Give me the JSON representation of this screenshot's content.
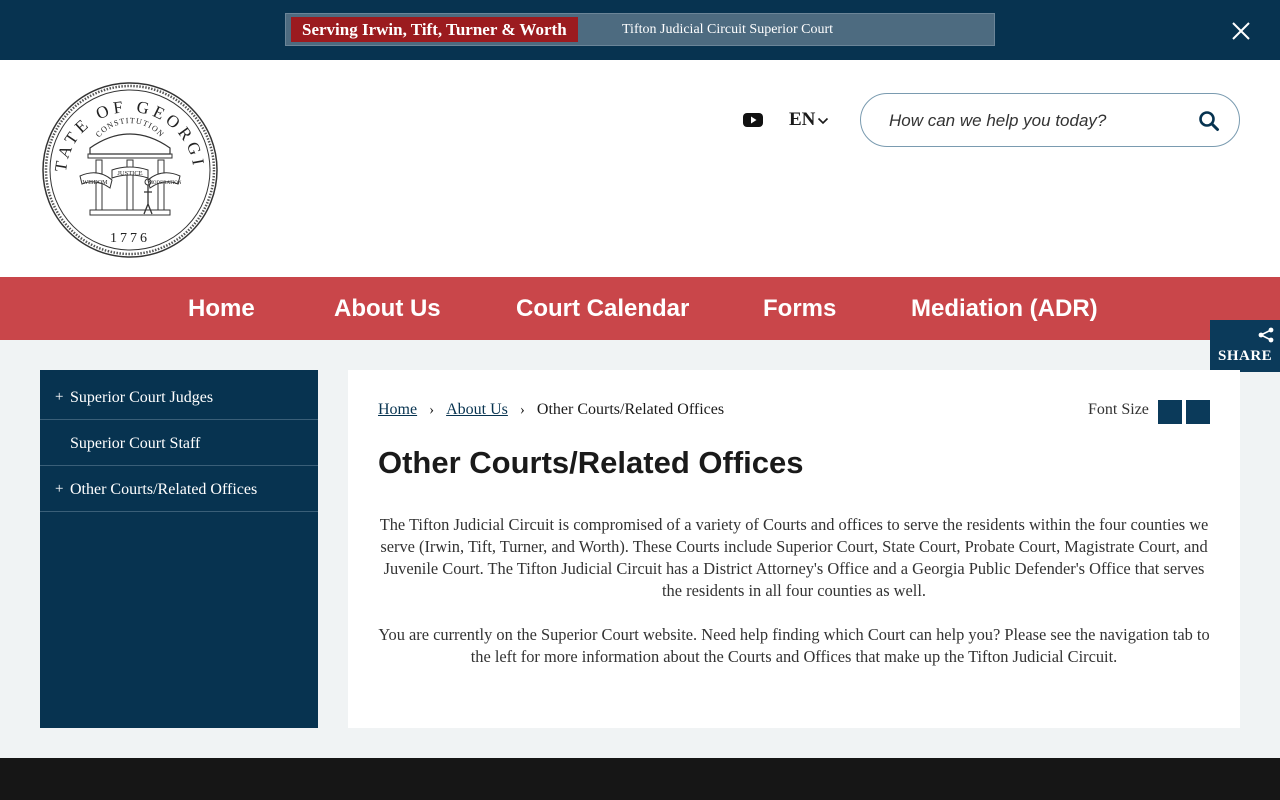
{
  "banner": {
    "tag": "Serving Irwin, Tift, Turner & Worth",
    "text": "Tifton Judicial Circuit Superior Court",
    "close_icon": "close-icon"
  },
  "header": {
    "seal": {
      "top_text": "STATE OF GEORGIA",
      "arch_text": "CONSTITUTION",
      "banner_left": "WISDOM",
      "banner_center": "JUSTICE",
      "banner_right": "MODERATION",
      "year": "1776"
    },
    "youtube_icon": "youtube-icon",
    "language": "EN",
    "search_placeholder": "How can we help you today?"
  },
  "nav": {
    "items": [
      "Home",
      "About Us",
      "Court Calendar",
      "Forms",
      "Mediation (ADR)"
    ]
  },
  "share": {
    "label": "SHARE"
  },
  "sidebar": {
    "items": [
      {
        "label": "Superior Court Judges",
        "expandable": true,
        "prefix": "+"
      },
      {
        "label": "Superior Court Staff",
        "expandable": false,
        "prefix": ""
      },
      {
        "label": "Other Courts/Related Offices",
        "expandable": true,
        "prefix": "+"
      }
    ]
  },
  "content": {
    "breadcrumb": [
      "Home",
      "About Us",
      "Other Courts/Related Offices"
    ],
    "breadcrumb_sep": "›",
    "font_size_label": "Font Size",
    "title": "Other Courts/Related Offices",
    "paragraphs": [
      "The Tifton Judicial Circuit is compromised of a variety of Courts and offices to serve the residents within the four counties we serve (Irwin, Tift, Turner, and Worth). These Courts include Superior Court, State Court, Probate Court, Magistrate Court, and Juvenile Court. The Tifton Judicial Circuit has a District Attorney's Office and a Georgia Public Defender's Office that serves the residents in all four counties as well.",
      "You are currently on the Superior Court website. Need help finding which Court can help you? Please see the navigation tab to the left for more information about the Courts and Offices that make up the Tifton Judicial Circuit."
    ]
  },
  "colors": {
    "navy": "#073350",
    "nav_red": "#c9464a",
    "tag_red": "#9b1b1f",
    "page_bg": "#f0f3f4"
  }
}
